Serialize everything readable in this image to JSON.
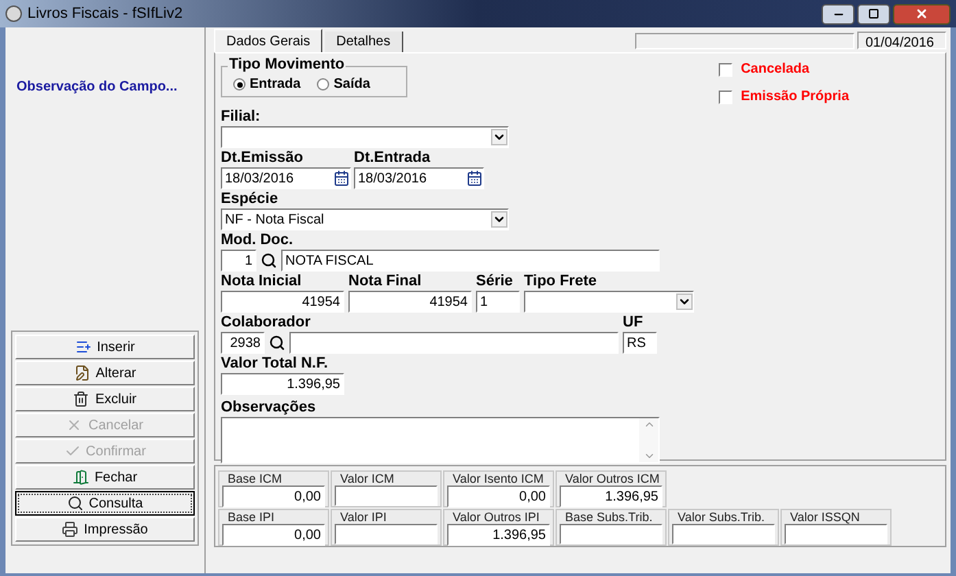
{
  "window": {
    "title": "Livros Fiscais - fSIfLiv2"
  },
  "sidebar": {
    "caption": "Observação do Campo...",
    "buttons": [
      {
        "label": "Inserir",
        "disabled": false,
        "focused": false
      },
      {
        "label": "Alterar",
        "disabled": false,
        "focused": false
      },
      {
        "label": "Excluir",
        "disabled": false,
        "focused": false
      },
      {
        "label": "Cancelar",
        "disabled": true,
        "focused": false
      },
      {
        "label": "Confirmar",
        "disabled": true,
        "focused": false
      },
      {
        "label": "Fechar",
        "disabled": false,
        "focused": false
      },
      {
        "label": "Consulta",
        "disabled": false,
        "focused": true
      },
      {
        "label": "Impressão",
        "disabled": false,
        "focused": false
      }
    ]
  },
  "tabs": [
    {
      "label": "Dados Gerais",
      "selected": true
    },
    {
      "label": "Detalhes",
      "selected": false
    }
  ],
  "date": "01/04/2016",
  "tipo_movimento": {
    "label": "Tipo Movimento",
    "options": [
      {
        "label": "Entrada",
        "selected": true
      },
      {
        "label": "Saída",
        "selected": false
      }
    ]
  },
  "flags": [
    {
      "label": "Cancelada",
      "checked": false
    },
    {
      "label": "Emissão Própria",
      "checked": false
    }
  ],
  "filial": {
    "label": "Filial:"
  },
  "dt_emissao": {
    "label": "Dt.Emissão",
    "value": "18/03/2016"
  },
  "dt_entrada": {
    "label": "Dt.Entrada",
    "value": "18/03/2016"
  },
  "especie": {
    "label": "Espécie",
    "value": "NF  - Nota Fiscal"
  },
  "mod_doc": {
    "label": "Mod. Doc.",
    "code": "1",
    "description": "NOTA FISCAL"
  },
  "nota_inicial": {
    "label": "Nota Inicial",
    "value": "41954"
  },
  "nota_final": {
    "label": "Nota Final",
    "value": "41954"
  },
  "serie": {
    "label": "Série",
    "value": "1"
  },
  "tipo_frete": {
    "label": "Tipo Frete"
  },
  "colaborador": {
    "label": "Colaborador",
    "code": "2938"
  },
  "uf": {
    "label": "UF",
    "value": "RS"
  },
  "valor_total": {
    "label": "Valor Total N.F.",
    "value": "1.396,95"
  },
  "observacoes": {
    "label": "Observações"
  },
  "totals": [
    {
      "fields": [
        {
          "label": "Base ICM",
          "value": "0,00"
        },
        {
          "label": "Valor ICM"
        },
        {
          "label": "Valor Isento ICM",
          "value": "0,00"
        },
        {
          "label": "Valor Outros ICM",
          "value": "1.396,95"
        }
      ]
    },
    {
      "fields": [
        {
          "label": "Base IPI",
          "value": "0,00"
        },
        {
          "label": "Valor IPI"
        },
        {
          "label": "Valor Outros IPI",
          "value": "1.396,95"
        },
        {
          "label": "Base Subs.Trib."
        },
        {
          "label": "Valor Subs.Trib."
        },
        {
          "label": "Valor ISSQN"
        }
      ]
    }
  ]
}
